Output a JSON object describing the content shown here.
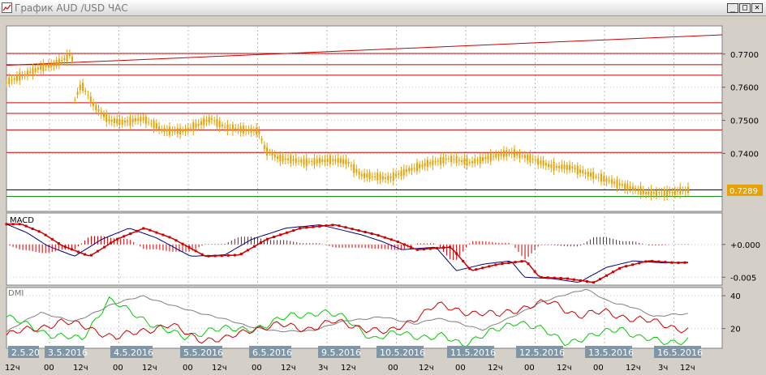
{
  "window": {
    "title": "График AUD /USD  ЧАС",
    "minimize_label": "_",
    "maximize_label": "□",
    "close_label": "✕"
  },
  "colors": {
    "background": "#ffffff",
    "candles": "#e8a100",
    "support_lines": "#cc0000",
    "current_price_line": "#000000",
    "green_line": "#008000",
    "macd_signal": "#cc0000",
    "macd_line": "#000080",
    "dmi_adx": "#808080",
    "dmi_plus": "#00cc00",
    "dmi_minus": "#cc0000",
    "date_label_bg": "#7f96a8"
  },
  "price_panel": {
    "y_ticks": [
      "0.7700",
      "0.7600",
      "0.7500",
      "0.7400"
    ],
    "current_price": "0.7289",
    "horizontal_levels": [
      0.7702,
      0.7668,
      0.7636,
      0.7553,
      0.7521,
      0.7471,
      0.7403,
      0.729
    ],
    "green_level": 0.727,
    "trendline": {
      "from": 0.7666,
      "to": 0.7758
    }
  },
  "macd_panel": {
    "label": "MACD",
    "y_ticks": [
      "+0.000",
      "-0.005"
    ]
  },
  "dmi_panel": {
    "label": "DMI",
    "y_ticks": [
      "40",
      "20"
    ]
  },
  "time_axis": {
    "dates": [
      "2.5.20",
      "3.5.2016",
      "4.5.2016",
      "5.5.2016",
      "6.5.2016",
      "9.5.2016",
      "10.5.2016",
      "11.5.2016",
      "12.5.2016",
      "13.5.2016",
      "16.5.2016"
    ],
    "ticks": [
      "12ч",
      "00",
      "12ч",
      "00",
      "12ч",
      "00",
      "12ч",
      "00",
      "12ч",
      "3ч",
      "12ч",
      "00",
      "12ч",
      "00",
      "12ч",
      "00",
      "12ч",
      "00",
      "12ч",
      "3ч",
      "12ч"
    ]
  },
  "chart_data": {
    "type": "line",
    "title": "График AUD /USD  ЧАС",
    "xlabel": "",
    "ylabel": "",
    "price_ylim": [
      0.7225,
      0.7785
    ],
    "price_anchors": [
      [
        0,
        0.7615
      ],
      [
        3,
        0.764
      ],
      [
        5,
        0.766
      ],
      [
        7,
        0.7668
      ],
      [
        9,
        0.769
      ],
      [
        9.6,
        0.7705
      ],
      [
        10,
        0.756
      ],
      [
        11,
        0.761
      ],
      [
        13,
        0.754
      ],
      [
        15,
        0.75
      ],
      [
        17,
        0.7495
      ],
      [
        20,
        0.7505
      ],
      [
        23,
        0.747
      ],
      [
        26,
        0.7468
      ],
      [
        28,
        0.7485
      ],
      [
        30,
        0.7505
      ],
      [
        32,
        0.748
      ],
      [
        35,
        0.747
      ],
      [
        37,
        0.7468
      ],
      [
        38,
        0.741
      ],
      [
        40,
        0.7385
      ],
      [
        44,
        0.7375
      ],
      [
        48,
        0.738
      ],
      [
        50,
        0.7375
      ],
      [
        52,
        0.7335
      ],
      [
        56,
        0.7325
      ],
      [
        59,
        0.735
      ],
      [
        62,
        0.737
      ],
      [
        65,
        0.7385
      ],
      [
        68,
        0.7372
      ],
      [
        71,
        0.739
      ],
      [
        74,
        0.7402
      ],
      [
        77,
        0.7385
      ],
      [
        80,
        0.736
      ],
      [
        83,
        0.7358
      ],
      [
        85,
        0.734
      ],
      [
        88,
        0.732
      ],
      [
        91,
        0.73
      ],
      [
        94,
        0.728
      ],
      [
        97,
        0.7282
      ],
      [
        100,
        0.7289
      ]
    ],
    "macd_ylim": [
      -0.0062,
      0.0048
    ],
    "macd_anchors": [
      [
        0,
        0.0031
      ],
      [
        3,
        0.0018
      ],
      [
        6,
        -0.0002
      ],
      [
        10,
        -0.0018
      ],
      [
        14,
        0.0008
      ],
      [
        18,
        0.0025
      ],
      [
        22,
        0.001
      ],
      [
        27,
        -0.0018
      ],
      [
        32,
        -0.0016
      ],
      [
        36,
        0.0008
      ],
      [
        41,
        0.0025
      ],
      [
        46,
        0.003
      ],
      [
        52,
        0.0015
      ],
      [
        55,
        0.0005
      ],
      [
        58,
        -0.0008
      ],
      [
        63,
        -0.0004
      ],
      [
        66,
        -0.004
      ],
      [
        70,
        -0.003
      ],
      [
        74,
        -0.0025
      ],
      [
        76,
        -0.005
      ],
      [
        80,
        -0.0052
      ],
      [
        84,
        -0.0058
      ],
      [
        88,
        -0.0035
      ],
      [
        92,
        -0.0025
      ],
      [
        96,
        -0.0028
      ],
      [
        100,
        -0.0027
      ]
    ],
    "dmi_ylim": [
      8,
      45
    ],
    "adx": [
      [
        0,
        18
      ],
      [
        5,
        30
      ],
      [
        10,
        24
      ],
      [
        15,
        34
      ],
      [
        20,
        40
      ],
      [
        25,
        33
      ],
      [
        30,
        28
      ],
      [
        35,
        22
      ],
      [
        40,
        18
      ],
      [
        45,
        19
      ],
      [
        50,
        25
      ],
      [
        55,
        27
      ],
      [
        60,
        23
      ],
      [
        63,
        26
      ],
      [
        66,
        24
      ],
      [
        70,
        19
      ],
      [
        75,
        29
      ],
      [
        78,
        35
      ],
      [
        82,
        41
      ],
      [
        85,
        44
      ],
      [
        88,
        37
      ],
      [
        92,
        33
      ],
      [
        95,
        27
      ],
      [
        98,
        29
      ],
      [
        100,
        29
      ]
    ],
    "di_plus": [
      [
        0,
        27
      ],
      [
        3,
        22
      ],
      [
        7,
        16
      ],
      [
        11,
        13
      ],
      [
        15,
        38
      ],
      [
        18,
        30
      ],
      [
        22,
        22
      ],
      [
        26,
        14
      ],
      [
        30,
        20
      ],
      [
        34,
        19
      ],
      [
        38,
        22
      ],
      [
        42,
        28
      ],
      [
        46,
        30
      ],
      [
        50,
        26
      ],
      [
        54,
        13
      ],
      [
        58,
        18
      ],
      [
        62,
        14
      ],
      [
        64,
        15
      ],
      [
        67,
        11
      ],
      [
        72,
        19
      ],
      [
        75,
        25
      ],
      [
        78,
        20
      ],
      [
        82,
        12
      ],
      [
        86,
        15
      ],
      [
        90,
        21
      ],
      [
        93,
        14
      ],
      [
        96,
        12
      ],
      [
        100,
        13
      ]
    ],
    "di_minus": [
      [
        0,
        16
      ],
      [
        4,
        20
      ],
      [
        8,
        24
      ],
      [
        12,
        21
      ],
      [
        16,
        14
      ],
      [
        20,
        19
      ],
      [
        24,
        22
      ],
      [
        28,
        14
      ],
      [
        32,
        13
      ],
      [
        36,
        20
      ],
      [
        40,
        22
      ],
      [
        44,
        20
      ],
      [
        48,
        24
      ],
      [
        52,
        21
      ],
      [
        56,
        17
      ],
      [
        63,
        34
      ],
      [
        68,
        30
      ],
      [
        72,
        28
      ],
      [
        74,
        31
      ],
      [
        77,
        34
      ],
      [
        80,
        36
      ],
      [
        84,
        28
      ],
      [
        88,
        30
      ],
      [
        92,
        26
      ],
      [
        96,
        23
      ],
      [
        100,
        19
      ]
    ]
  }
}
